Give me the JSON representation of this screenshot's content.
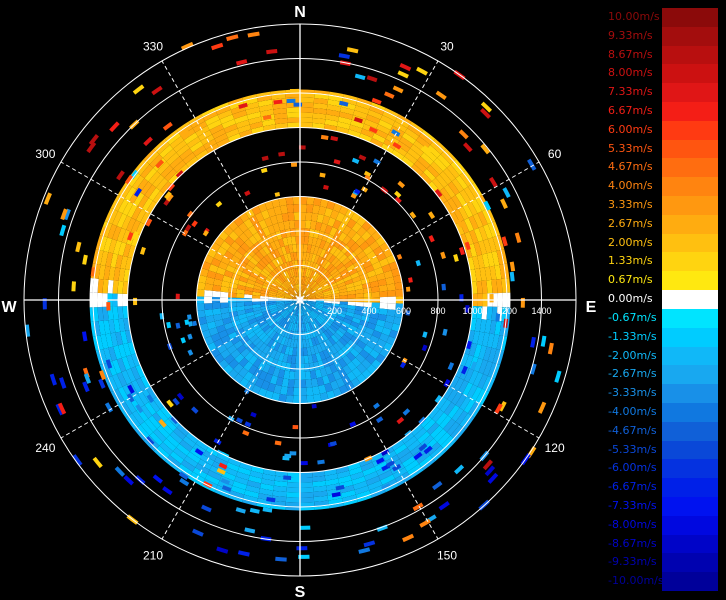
{
  "chart_data": {
    "type": "polar-radar-velocity",
    "compass": {
      "north": "N",
      "east": "E",
      "south": "S",
      "west": "W"
    },
    "angle_ticks": [
      "30",
      "60",
      "120",
      "150",
      "210",
      "240",
      "300",
      "330"
    ],
    "angle_tick_degrees": [
      30,
      60,
      120,
      150,
      210,
      240,
      300,
      330
    ],
    "range_ticks": [
      "200",
      "400",
      "600",
      "800",
      "1000",
      "1200",
      "1400"
    ],
    "range_tick_values": [
      200,
      400,
      600,
      800,
      1000,
      1200,
      1400
    ],
    "range_max": 1600,
    "grid": true,
    "legend_position": "right",
    "legend": [
      {
        "label": "10.00m/s",
        "color": "#8b0a0a"
      },
      {
        "label": "9.33m/s",
        "color": "#a30d0d"
      },
      {
        "label": "8.67m/s",
        "color": "#b80f0f"
      },
      {
        "label": "8.00m/s",
        "color": "#cc1111"
      },
      {
        "label": "7.33m/s",
        "color": "#e01616"
      },
      {
        "label": "6.67m/s",
        "color": "#f41e16"
      },
      {
        "label": "6.00m/s",
        "color": "#ff3a12"
      },
      {
        "label": "5.33m/s",
        "color": "#ff5510"
      },
      {
        "label": "4.67m/s",
        "color": "#ff6d10"
      },
      {
        "label": "4.00m/s",
        "color": "#ff8410"
      },
      {
        "label": "3.33m/s",
        "color": "#ff9810"
      },
      {
        "label": "2.67m/s",
        "color": "#ffac10"
      },
      {
        "label": "2.00m/s",
        "color": "#ffc010"
      },
      {
        "label": "1.33m/s",
        "color": "#ffd410"
      },
      {
        "label": "0.67m/s",
        "color": "#ffe810"
      },
      {
        "label": "0.00m/s",
        "color": "#ffffff"
      },
      {
        "label": "-0.67m/s",
        "color": "#00e4ff"
      },
      {
        "label": "-1.33m/s",
        "color": "#00ccff"
      },
      {
        "label": "-2.00m/s",
        "color": "#10b8f8"
      },
      {
        "label": "-2.67m/s",
        "color": "#18a8f0"
      },
      {
        "label": "-3.33m/s",
        "color": "#1890e8"
      },
      {
        "label": "-4.00m/s",
        "color": "#1078e0"
      },
      {
        "label": "-4.67m/s",
        "color": "#1060d8"
      },
      {
        "label": "-5.33m/s",
        "color": "#0a48d8"
      },
      {
        "label": "-6.00m/s",
        "color": "#0532e0"
      },
      {
        "label": "-6.67m/s",
        "color": "#0020e8"
      },
      {
        "label": "-7.33m/s",
        "color": "#0012f0"
      },
      {
        "label": "-8.00m/s",
        "color": "#0008e0"
      },
      {
        "label": "-8.67m/s",
        "color": "#0004c8"
      },
      {
        "label": "-9.33m/s",
        "color": "#0002b0"
      },
      {
        "label": "-10.00m/s",
        "color": "#00009a"
      }
    ],
    "bands": [
      {
        "name": "inner",
        "range": [
          0,
          600
        ],
        "approaching_half": "north",
        "approaching_velocity": 2.67,
        "receding_velocity": -2.67
      },
      {
        "name": "outer-ring",
        "range": [
          1000,
          1220
        ],
        "approaching_half": "north",
        "approaching_velocity": 2.0,
        "receding_velocity": -2.0
      }
    ]
  }
}
